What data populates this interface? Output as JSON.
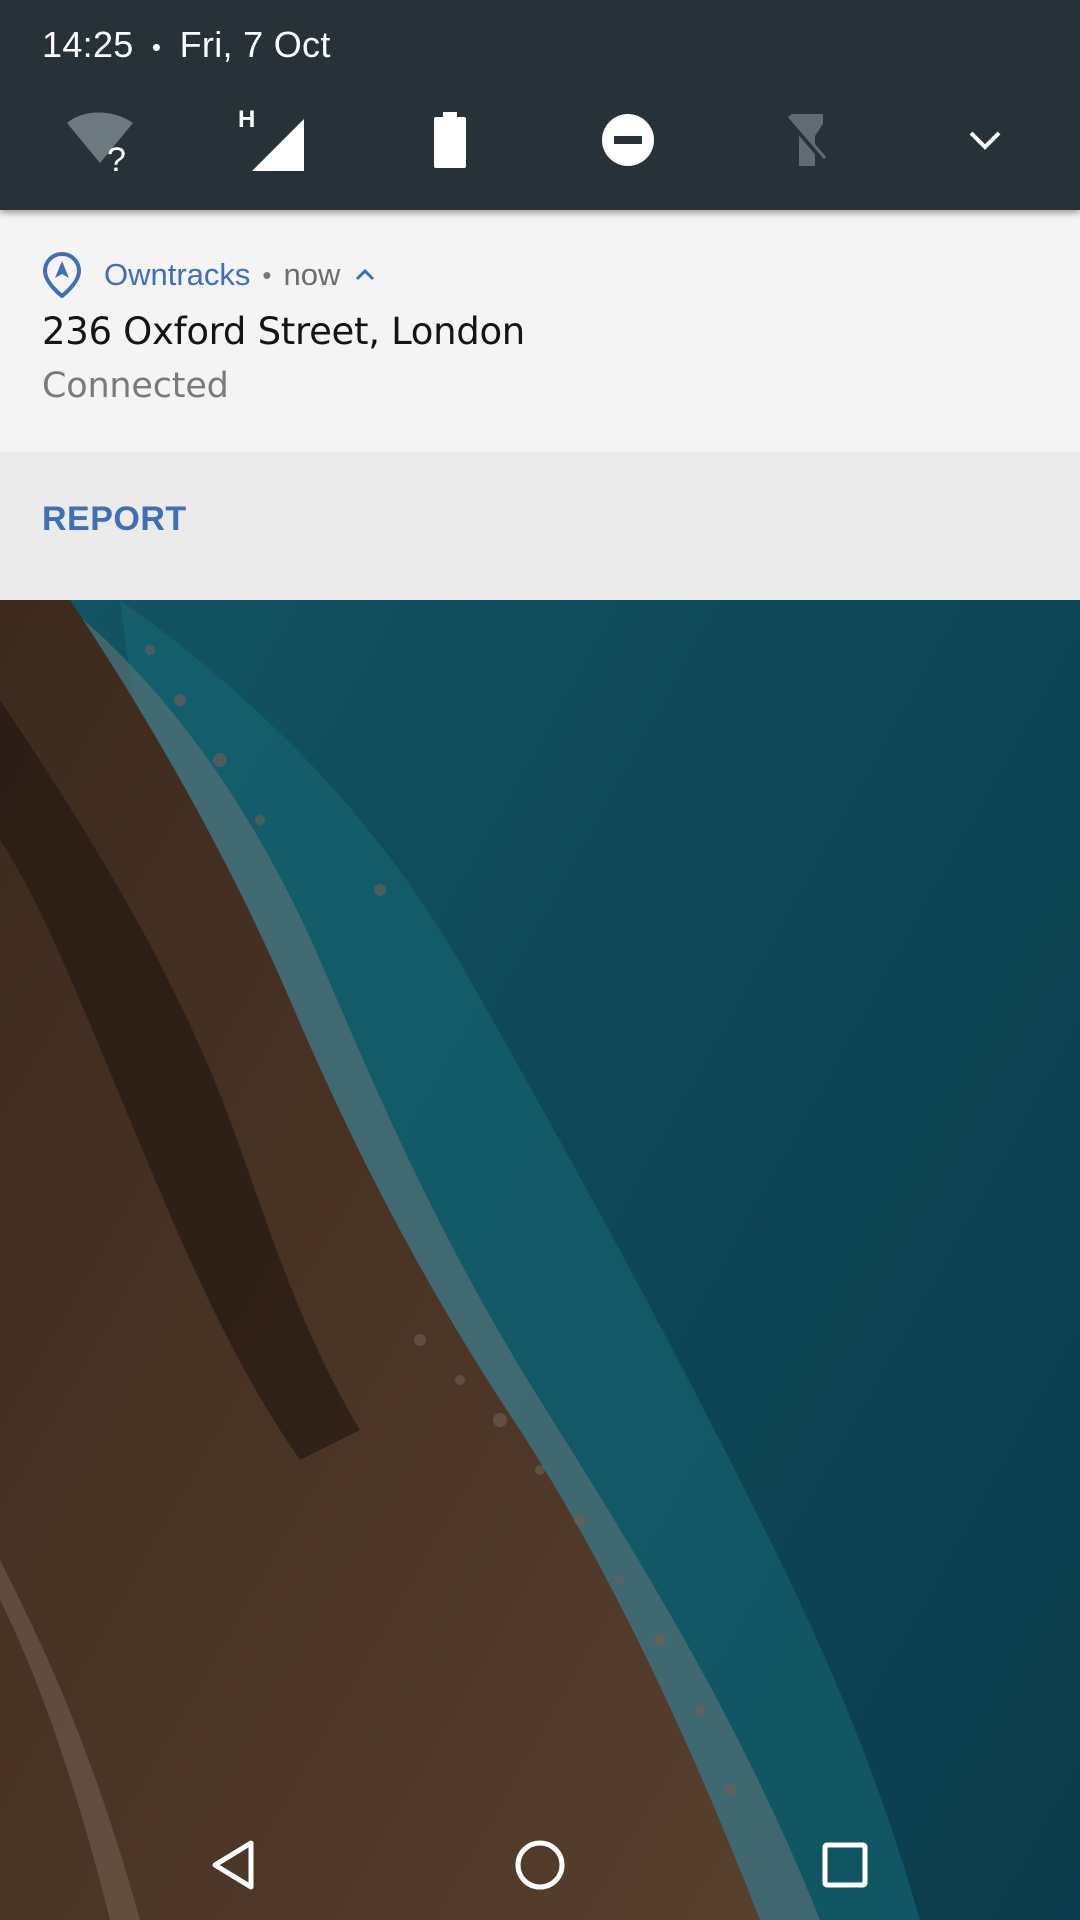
{
  "status": {
    "time": "14:25",
    "separator": "•",
    "date": "Fri, 7 Oct",
    "network_type": "H",
    "wifi_unknown_mark": "?"
  },
  "quick_settings": {
    "icons": [
      "wifi-unknown-icon",
      "cell-signal-icon",
      "battery-icon",
      "do-not-disturb-icon",
      "flashlight-off-icon",
      "expand-chevron-icon"
    ]
  },
  "notification": {
    "app_name": "Owntracks",
    "dot": "•",
    "time": "now",
    "title": "236 Oxford Street, London",
    "text": "Connected",
    "action_label": "REPORT",
    "accent_color": "#3f6fb6"
  },
  "navigation": {
    "icons": [
      "back-icon",
      "home-icon",
      "recents-icon"
    ]
  },
  "colors": {
    "header_bg": "#263238",
    "card_bg": "#f4f4f4",
    "action_bg": "#ebebeb",
    "sea": "#1f6f80",
    "land": "#5a3d2b"
  }
}
